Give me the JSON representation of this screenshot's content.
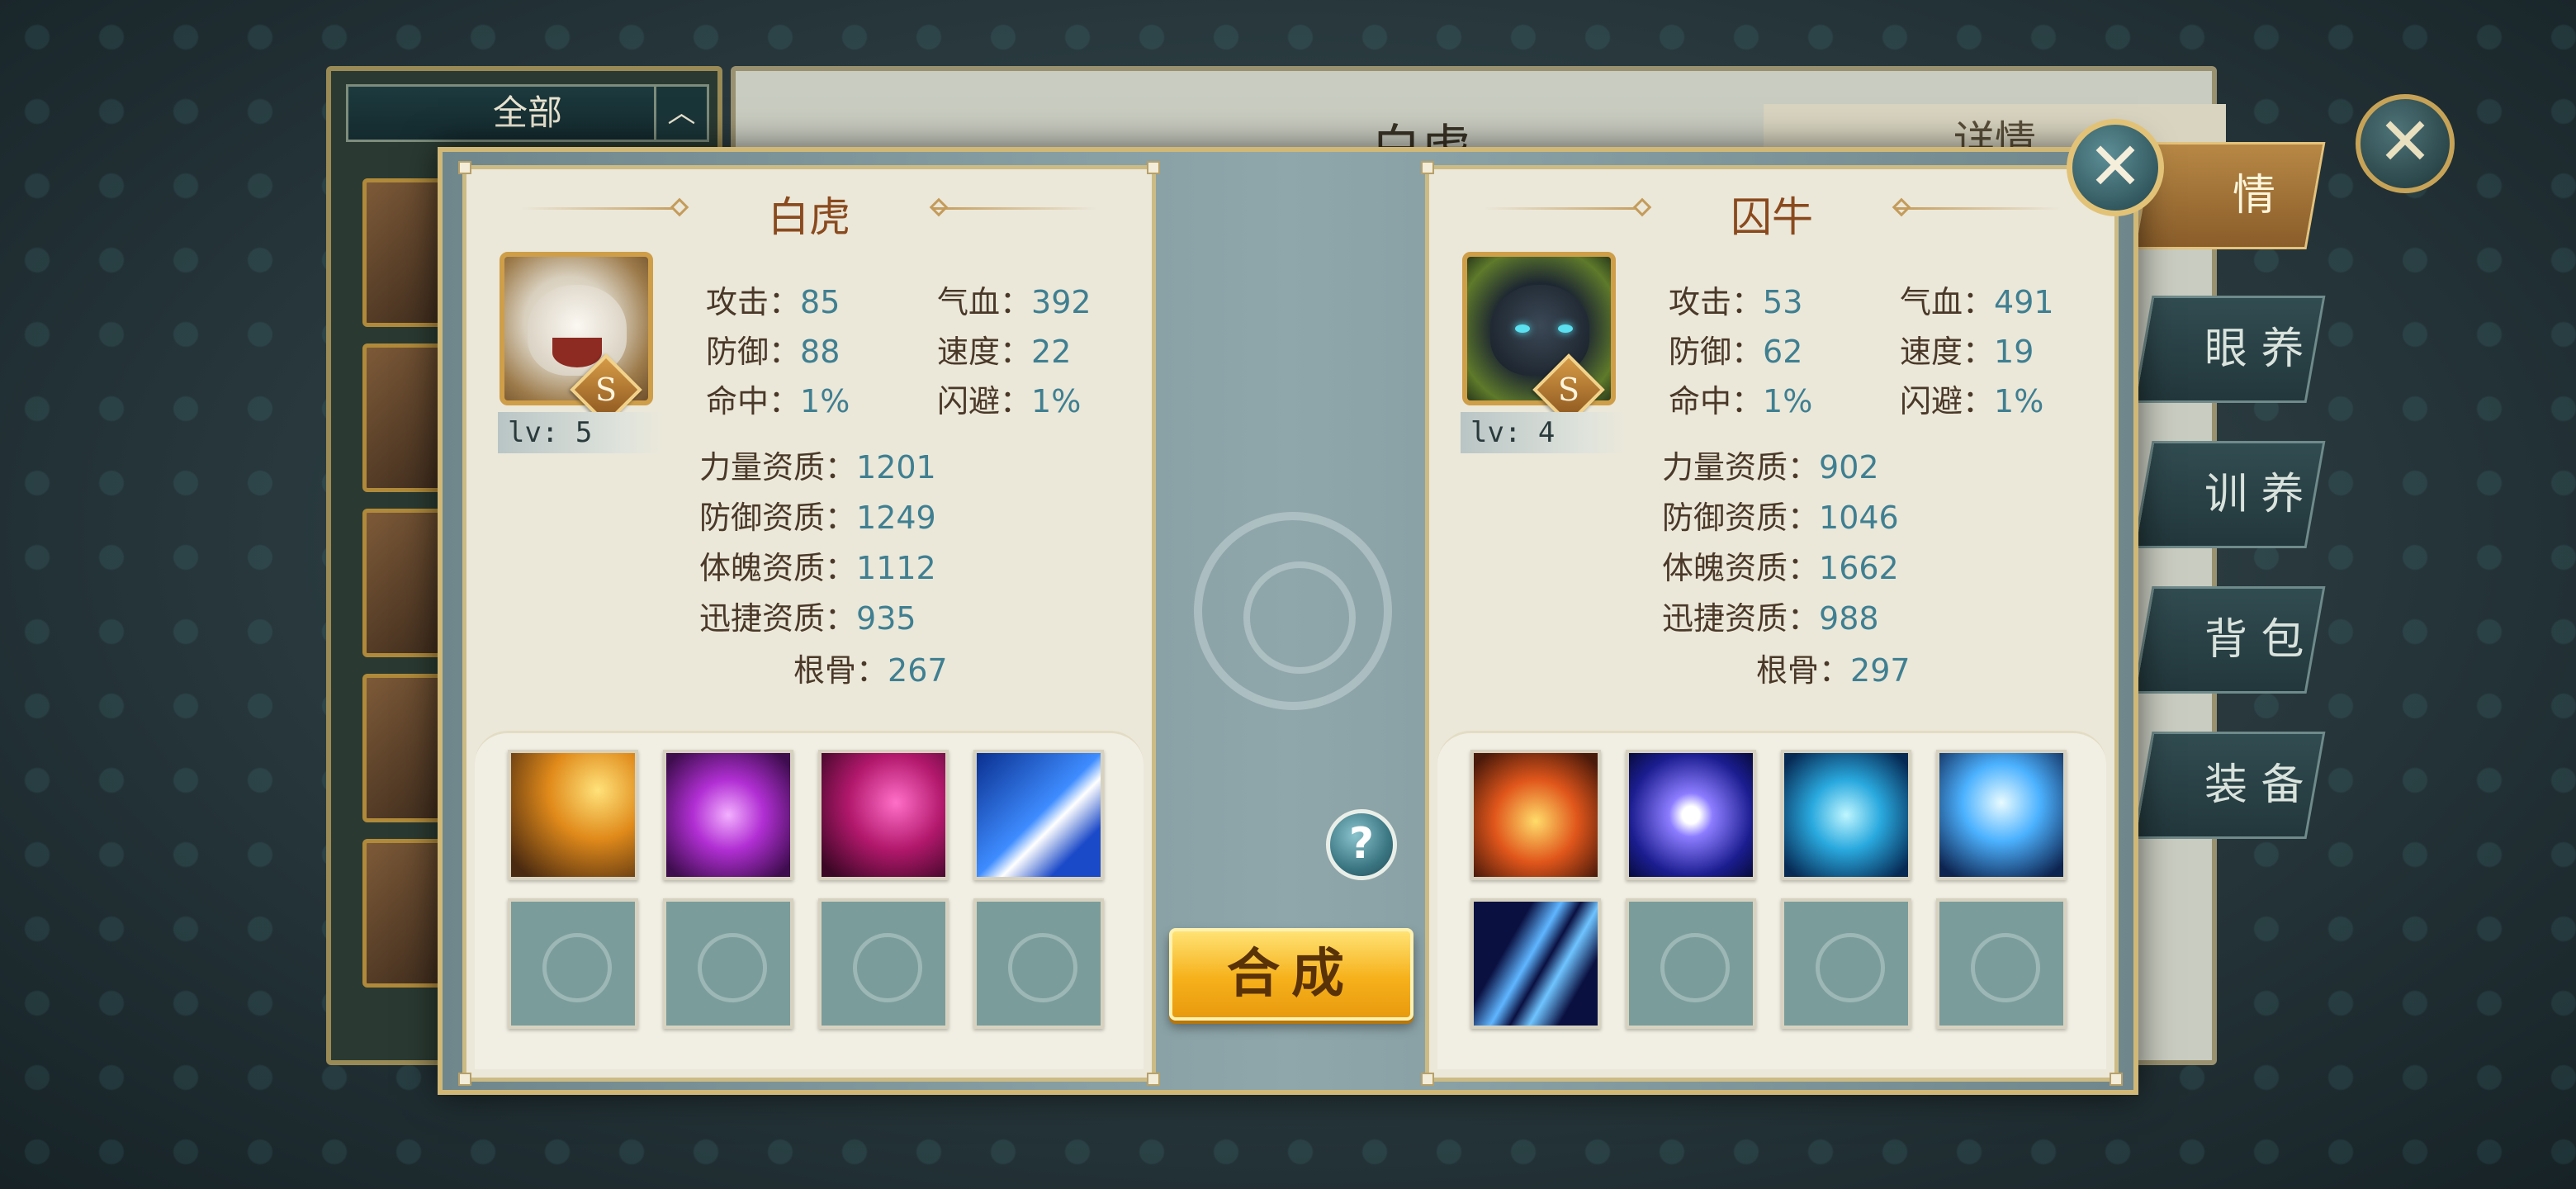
{
  "background": {
    "filter_label": "全部",
    "filter_chevron": "︿",
    "main_title": "白虎",
    "detail_tab": "详情",
    "side_tabs": [
      "情",
      "眼 养",
      "训 养",
      "背 包",
      "装 备"
    ],
    "close_glyph": "✕"
  },
  "dialog": {
    "close_glyph": "✕",
    "help_glyph": "?",
    "compose_label": "合成",
    "left": {
      "name": "白虎",
      "grade": "S",
      "level": "lv: 5",
      "stats": [
        {
          "k": "攻击：",
          "v": "85"
        },
        {
          "k": "气血：",
          "v": "392"
        },
        {
          "k": "防御：",
          "v": "88"
        },
        {
          "k": "速度：",
          "v": "22"
        },
        {
          "k": "命中：",
          "v": "1%"
        },
        {
          "k": "闪避：",
          "v": "1%"
        }
      ],
      "aptitudes": [
        {
          "k": "力量资质：",
          "v": "1201"
        },
        {
          "k": "防御资质：",
          "v": "1249"
        },
        {
          "k": "体魄资质：",
          "v": "1112"
        },
        {
          "k": "迅捷资质：",
          "v": "935"
        },
        {
          "k": "根骨：",
          "v": "267"
        }
      ],
      "skills": [
        "sk-yellow",
        "sk-purple",
        "sk-magenta",
        "sk-blue",
        "empty",
        "empty",
        "empty",
        "empty"
      ]
    },
    "right": {
      "name": "囚牛",
      "grade": "S",
      "level": "lv: 4",
      "stats": [
        {
          "k": "攻击：",
          "v": "53"
        },
        {
          "k": "气血：",
          "v": "491"
        },
        {
          "k": "防御：",
          "v": "62"
        },
        {
          "k": "速度：",
          "v": "19"
        },
        {
          "k": "命中：",
          "v": "1%"
        },
        {
          "k": "闪避：",
          "v": "1%"
        }
      ],
      "aptitudes": [
        {
          "k": "力量资质：",
          "v": "902"
        },
        {
          "k": "防御资质：",
          "v": "1046"
        },
        {
          "k": "体魄资质：",
          "v": "1662"
        },
        {
          "k": "迅捷资质：",
          "v": "988"
        },
        {
          "k": "根骨：",
          "v": "297"
        }
      ],
      "skills": [
        "sk-fire",
        "sk-orb",
        "sk-cyan",
        "sk-heart",
        "sk-claw",
        "empty",
        "empty",
        "empty"
      ]
    }
  }
}
